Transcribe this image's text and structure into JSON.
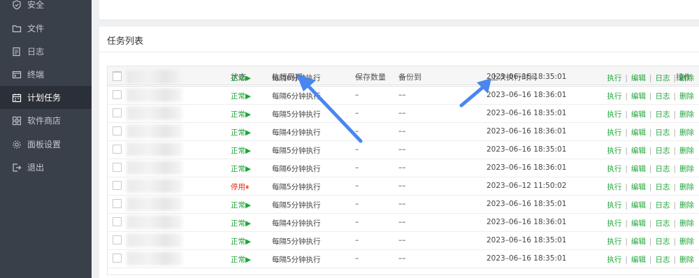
{
  "sidebar": {
    "items": [
      {
        "label": "安全",
        "icon": "shield-icon"
      },
      {
        "label": "文件",
        "icon": "folder-icon"
      },
      {
        "label": "日志",
        "icon": "log-icon"
      },
      {
        "label": "终端",
        "icon": "terminal-icon"
      },
      {
        "label": "计划任务",
        "icon": "calendar-icon",
        "active": true
      },
      {
        "label": "软件商店",
        "icon": "apps-icon"
      },
      {
        "label": "面板设置",
        "icon": "gear-icon"
      },
      {
        "label": "退出",
        "icon": "logout-icon"
      }
    ]
  },
  "panel": {
    "title": "任务列表",
    "headers": {
      "status": "状态",
      "cycle": "执行周期",
      "save_count": "保存数量",
      "backup_to": "备份到",
      "next_run": "上次执行时间",
      "actions": "操作"
    },
    "actions": {
      "run": "执行",
      "edit": "编辑",
      "log": "日志",
      "delete": "删除",
      "separator": "|"
    },
    "rows": [
      {
        "status": "正常▶",
        "status_type": "ok",
        "cycle": "每隔6分钟执行",
        "save": "–",
        "backup": "––",
        "time": "2023–06–16 18:35:01"
      },
      {
        "status": "正常▶",
        "status_type": "ok",
        "cycle": "每隔6分钟执行",
        "save": "–",
        "backup": "––",
        "time": "2023–06–16 18:36:01"
      },
      {
        "status": "正常▶",
        "status_type": "ok",
        "cycle": "每隔5分钟执行",
        "save": "–",
        "backup": "––",
        "time": "2023–06–16 18:35:01"
      },
      {
        "status": "正常▶",
        "status_type": "ok",
        "cycle": "每隔4分钟执行",
        "save": "–",
        "backup": "––",
        "time": "2023–06–16 18:36:01"
      },
      {
        "status": "正常▶",
        "status_type": "ok",
        "cycle": "每隔5分钟执行",
        "save": "–",
        "backup": "––",
        "time": "2023–06–16 18:35:01"
      },
      {
        "status": "正常▶",
        "status_type": "ok",
        "cycle": "每隔6分钟执行",
        "save": "–",
        "backup": "––",
        "time": "2023–06–16 18:36:01"
      },
      {
        "status": "停用⏸",
        "status_type": "stop",
        "cycle": "每隔5分钟执行",
        "save": "–",
        "backup": "––",
        "time": "2023–06–12 11:50:02"
      },
      {
        "status": "正常▶",
        "status_type": "ok",
        "cycle": "每隔5分钟执行",
        "save": "–",
        "backup": "––",
        "time": "2023–06–16 18:35:01"
      },
      {
        "status": "正常▶",
        "status_type": "ok",
        "cycle": "每隔4分钟执行",
        "save": "–",
        "backup": "––",
        "time": "2023–06–16 18:36:01"
      },
      {
        "status": "正常▶",
        "status_type": "ok",
        "cycle": "每隔5分钟执行",
        "save": "–",
        "backup": "––",
        "time": "2023–06–16 18:35:01"
      },
      {
        "status": "正常▶",
        "status_type": "ok",
        "cycle": "每隔5分钟执行",
        "save": "–",
        "backup": "––",
        "time": "2023–06–16 18:35:01"
      }
    ]
  },
  "colors": {
    "accent": "#20a53a",
    "danger": "#e0301e",
    "arrow": "#4a86f0",
    "sidebar_bg": "#3a4049"
  }
}
